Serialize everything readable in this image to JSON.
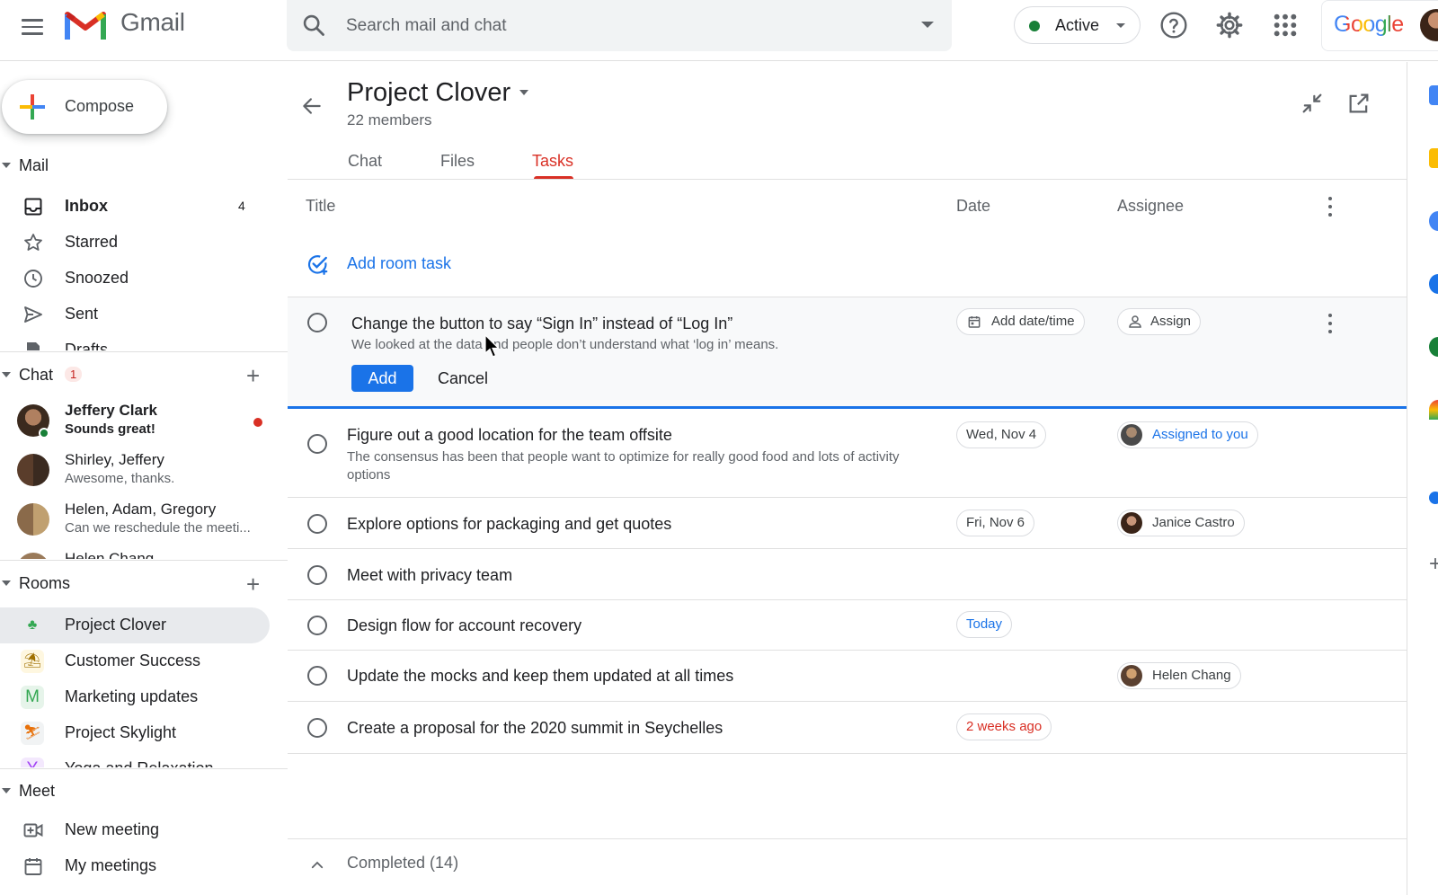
{
  "topbar": {
    "app_name": "Gmail",
    "search_placeholder": "Search mail and chat",
    "status_label": "Active",
    "brand_word": "Google"
  },
  "sidebar": {
    "compose_label": "Compose",
    "mail": {
      "heading": "Mail",
      "items": [
        {
          "label": "Inbox",
          "count": "4",
          "icon": "inbox-icon"
        },
        {
          "label": "Starred",
          "count": "",
          "icon": "star-icon"
        },
        {
          "label": "Snoozed",
          "count": "",
          "icon": "clock-icon"
        },
        {
          "label": "Sent",
          "count": "",
          "icon": "send-icon"
        },
        {
          "label": "Drafts",
          "count": "",
          "icon": "draft-icon"
        }
      ]
    },
    "chat": {
      "heading": "Chat",
      "badge": "1",
      "items": [
        {
          "name": "Jeffery Clark",
          "preview": "Sounds great!",
          "unread": true
        },
        {
          "name": "Shirley, Jeffery",
          "preview": "Awesome, thanks."
        },
        {
          "name": "Helen, Adam, Gregory",
          "preview": "Can we reschedule the meeti..."
        },
        {
          "name": "Helen Chang",
          "preview": ""
        }
      ]
    },
    "rooms": {
      "heading": "Rooms",
      "items": [
        {
          "label": "Project Clover",
          "icon": "clover-icon",
          "selected": true
        },
        {
          "label": "Customer Success",
          "icon": "island-icon"
        },
        {
          "label": "Marketing updates",
          "icon": "letter-m-icon",
          "letter": "M"
        },
        {
          "label": "Project Skylight",
          "icon": "skier-icon"
        },
        {
          "label": "Yoga and Relaxation",
          "icon": "letter-y-icon",
          "letter": "Y"
        }
      ]
    },
    "meet": {
      "heading": "Meet",
      "items": [
        {
          "label": "New meeting",
          "icon": "video-add-icon"
        },
        {
          "label": "My meetings",
          "icon": "calendar-icon"
        }
      ]
    }
  },
  "room": {
    "title": "Project Clover",
    "members": "22 members",
    "tabs": [
      {
        "label": "Chat"
      },
      {
        "label": "Files"
      },
      {
        "label": "Tasks",
        "selected": true
      }
    ]
  },
  "tasks": {
    "columns": {
      "title": "Title",
      "date": "Date",
      "assignee": "Assignee"
    },
    "add_task_label": "Add room task",
    "editing": {
      "title": "Change the button to say “Sign In” instead of “Log In”",
      "description": "We looked at the data and people don’t understand what ‘log in’ means.",
      "date_chip": "Add date/time",
      "assign_chip": "Assign",
      "add_button": "Add",
      "cancel_button": "Cancel"
    },
    "items": [
      {
        "title": "Figure out a good location for the team offsite",
        "description": "The consensus has been that people want to optimize for really good food and lots of activity options",
        "date": "Wed, Nov 4",
        "date_style": "normal",
        "assignee": "Assigned to you",
        "assignee_style": "blue"
      },
      {
        "title": "Explore options for packaging and get quotes",
        "description": "",
        "date": "Fri, Nov 6",
        "date_style": "normal",
        "assignee": "Janice Castro",
        "assignee_style": "normal"
      },
      {
        "title": "Meet with privacy team",
        "description": "",
        "date": "",
        "assignee": ""
      },
      {
        "title": "Design flow for account recovery",
        "description": "",
        "date": "Today",
        "date_style": "blue",
        "assignee": ""
      },
      {
        "title": "Update the mocks and keep them updated at all times",
        "description": "",
        "date": "",
        "assignee": "Helen Chang",
        "assignee_style": "normal"
      },
      {
        "title": "Create a proposal for the 2020 summit in Seychelles",
        "description": "",
        "date": "2 weeks ago",
        "date_style": "red",
        "assignee": ""
      }
    ],
    "completed_label": "Completed (14)"
  },
  "colors": {
    "accent_blue": "#1a73e8",
    "accent_red": "#d93025",
    "active_green": "#188038"
  }
}
